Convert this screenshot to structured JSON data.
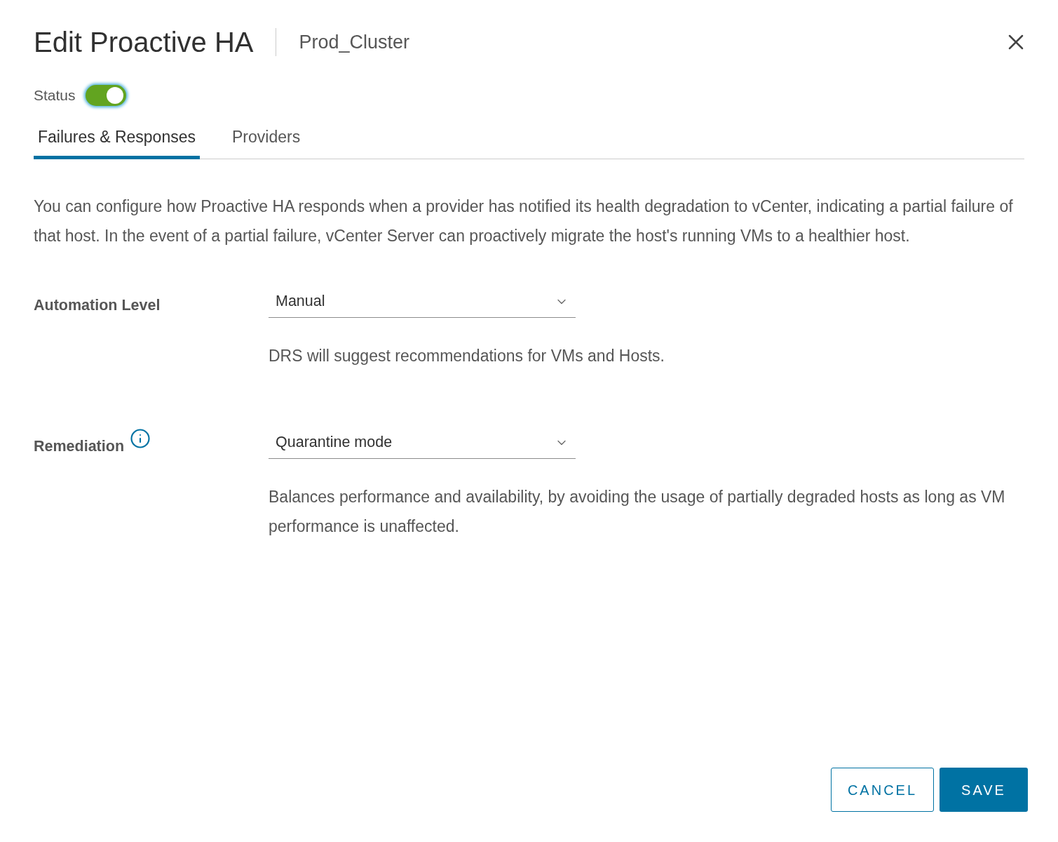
{
  "dialog": {
    "title": "Edit Proactive HA",
    "subtitle": "Prod_Cluster"
  },
  "status": {
    "label": "Status",
    "on": true
  },
  "tabs": [
    {
      "label": "Failures & Responses",
      "selected": true
    },
    {
      "label": "Providers",
      "selected": false
    }
  ],
  "description": "You can configure how Proactive HA responds when a provider has notified its health degradation to vCenter, indicating a partial failure of that host. In the event of a partial failure, vCenter Server can proactively migrate the host's running VMs to a healthier host.",
  "fields": [
    {
      "label": "Automation Level",
      "info": false,
      "value": "Manual",
      "help": "DRS will suggest recommendations for VMs and Hosts."
    },
    {
      "label": "Remediation",
      "info": true,
      "value": "Quarantine mode",
      "help": "Balances performance and availability, by avoiding the usage of partially degraded hosts as long as VM performance is unaffected."
    }
  ],
  "buttons": [
    {
      "label": "CANCEL",
      "kind": "secondary"
    },
    {
      "label": "SAVE",
      "kind": "primary"
    }
  ]
}
